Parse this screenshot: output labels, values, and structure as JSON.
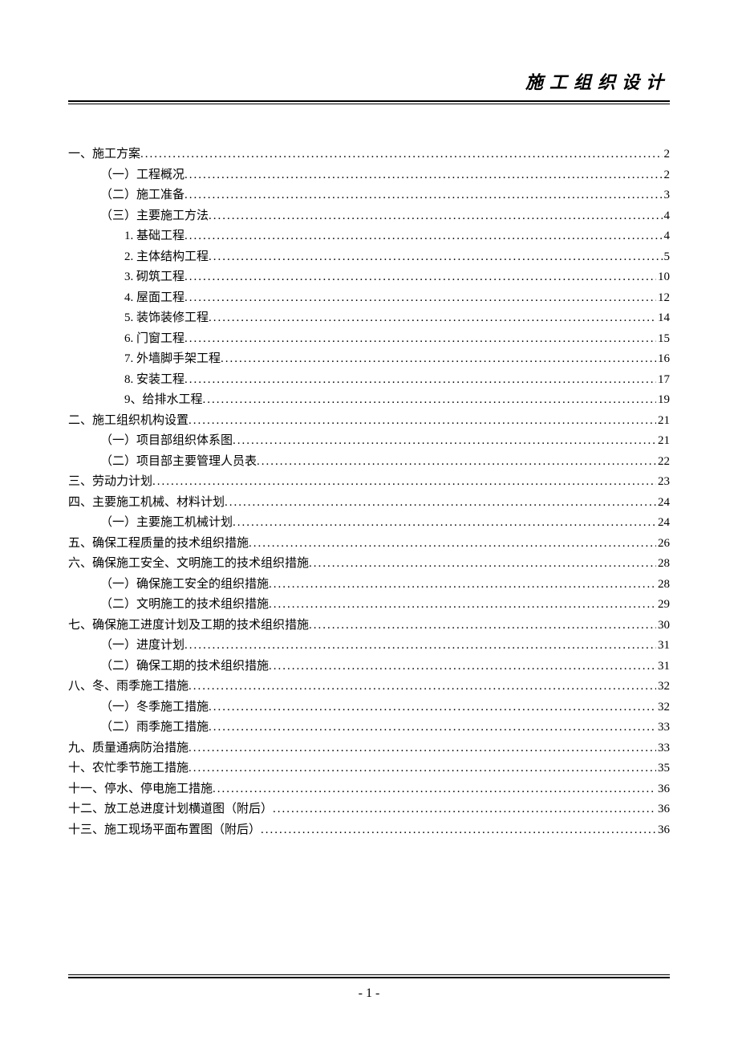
{
  "header": {
    "title": "施工组织设计"
  },
  "toc": [
    {
      "label": "一、施工方案",
      "page": "2",
      "indent": 0
    },
    {
      "label": "（一）工程概况",
      "page": "2",
      "indent": 1
    },
    {
      "label": "（二）施工准备",
      "page": "3",
      "indent": 1
    },
    {
      "label": "（三）主要施工方法",
      "page": "4",
      "indent": 1
    },
    {
      "label": "1. 基础工程",
      "page": "4",
      "indent": 2
    },
    {
      "label": "2. 主体结构工程",
      "page": "5",
      "indent": 2
    },
    {
      "label": "3. 砌筑工程",
      "page": "10",
      "indent": 2
    },
    {
      "label": "4. 屋面工程",
      "page": "12",
      "indent": 2
    },
    {
      "label": "5. 装饰装修工程",
      "page": "14",
      "indent": 2
    },
    {
      "label": "6. 门窗工程",
      "page": "15",
      "indent": 2
    },
    {
      "label": "7. 外墙脚手架工程",
      "page": "16",
      "indent": 2
    },
    {
      "label": "8. 安装工程",
      "page": "17",
      "indent": 2
    },
    {
      "label": "9、给排水工程",
      "page": "19",
      "indent": 2
    },
    {
      "label": "二、施工组织机构设置",
      "page": "21",
      "indent": 0
    },
    {
      "label": "（一）项目部组织体系图",
      "page": "21",
      "indent": 1
    },
    {
      "label": "（二）项目部主要管理人员表",
      "page": "22",
      "indent": 1
    },
    {
      "label": "三、劳动力计划",
      "page": "23",
      "indent": 0
    },
    {
      "label": "四、主要施工机械、材料计划",
      "page": "24",
      "indent": 0
    },
    {
      "label": "（一）主要施工机械计划",
      "page": "24",
      "indent": 1
    },
    {
      "label": "五、确保工程质量的技术组织措施",
      "page": "26",
      "indent": 0
    },
    {
      "label": "六、确保施工安全、文明施工的技术组织措施",
      "page": "28",
      "indent": 0
    },
    {
      "label": "（一）确保施工安全的组织措施",
      "page": "28",
      "indent": 1
    },
    {
      "label": "（二）文明施工的技术组织措施",
      "page": "29",
      "indent": 1
    },
    {
      "label": "七、确保施工进度计划及工期的技术组织措施",
      "page": "30",
      "indent": 0
    },
    {
      "label": "（一）进度计划",
      "page": "31",
      "indent": 1
    },
    {
      "label": "（二）确保工期的技术组织措施",
      "page": "31",
      "indent": 1
    },
    {
      "label": "八、冬、雨季施工措施",
      "page": "32",
      "indent": 0
    },
    {
      "label": "（一）冬季施工措施",
      "page": "32",
      "indent": 1
    },
    {
      "label": "（二）雨季施工措施",
      "page": "33",
      "indent": 1
    },
    {
      "label": "九、质量通病防治措施",
      "page": "33",
      "indent": 0
    },
    {
      "label": "十、农忙季节施工措施",
      "page": "35",
      "indent": 0
    },
    {
      "label": "十一、停水、停电施工措施",
      "page": "36",
      "indent": 0
    },
    {
      "label": "十二、放工总进度计划横道图（附后）",
      "page": "36",
      "indent": 0
    },
    {
      "label": "十三、施工现场平面布置图（附后）",
      "page": "36",
      "indent": 0
    }
  ],
  "footer": {
    "page_number": "- 1 -"
  }
}
